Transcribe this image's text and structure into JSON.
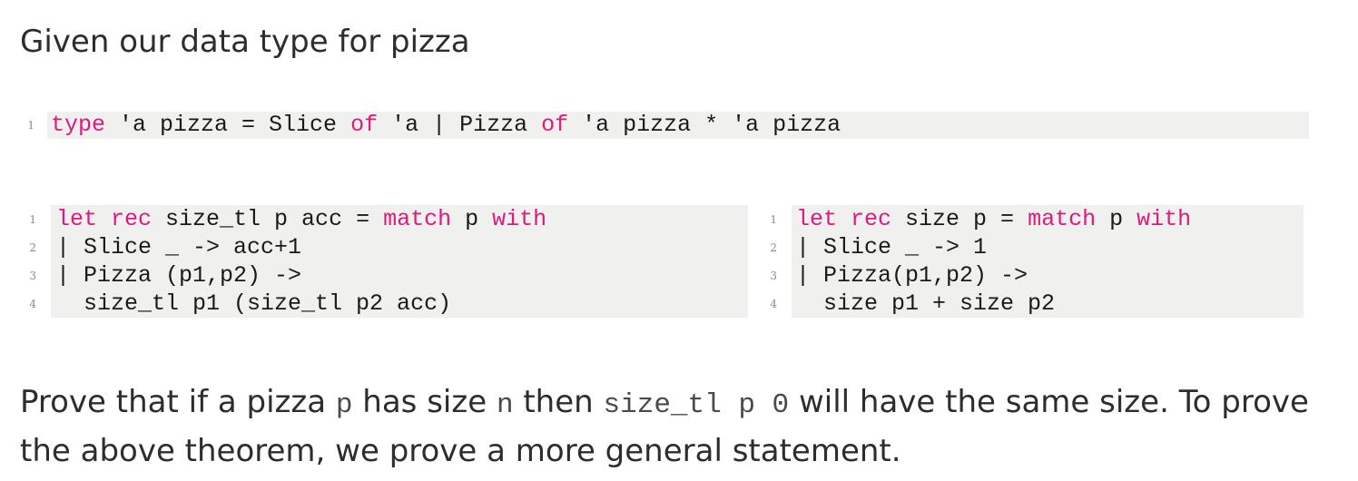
{
  "heading": "Given our data type for pizza",
  "type_block": {
    "lines": [
      {
        "num": "1",
        "tokens": [
          {
            "text": "type",
            "kw": true
          },
          {
            "text": " 'a pizza = Slice ",
            "kw": false
          },
          {
            "text": "of",
            "kw": true
          },
          {
            "text": " 'a | Pizza ",
            "kw": false
          },
          {
            "text": "of",
            "kw": true
          },
          {
            "text": " 'a pizza * 'a pizza",
            "kw": false
          }
        ]
      }
    ]
  },
  "size_tl_block": {
    "lines": [
      {
        "num": "1",
        "tokens": [
          {
            "text": "let rec",
            "kw": true
          },
          {
            "text": " size_tl p acc = ",
            "kw": false
          },
          {
            "text": "match",
            "kw": true
          },
          {
            "text": " p ",
            "kw": false
          },
          {
            "text": "with",
            "kw": true
          }
        ]
      },
      {
        "num": "2",
        "tokens": [
          {
            "text": "| Slice _ -> acc+1",
            "kw": false
          }
        ]
      },
      {
        "num": "3",
        "tokens": [
          {
            "text": "| Pizza (p1,p2) ->",
            "kw": false
          }
        ]
      },
      {
        "num": "4",
        "tokens": [
          {
            "text": "  size_tl p1 (size_tl p2 acc)",
            "kw": false
          }
        ]
      }
    ]
  },
  "size_block": {
    "lines": [
      {
        "num": "1",
        "tokens": [
          {
            "text": "let rec",
            "kw": true
          },
          {
            "text": " size p = ",
            "kw": false
          },
          {
            "text": "match",
            "kw": true
          },
          {
            "text": " p ",
            "kw": false
          },
          {
            "text": "with",
            "kw": true
          }
        ]
      },
      {
        "num": "2",
        "tokens": [
          {
            "text": "| Slice _ -> 1",
            "kw": false
          }
        ]
      },
      {
        "num": "3",
        "tokens": [
          {
            "text": "| Pizza(p1,p2) ->",
            "kw": false
          }
        ]
      },
      {
        "num": "4",
        "tokens": [
          {
            "text": "  size p1 + size p2",
            "kw": false
          }
        ]
      }
    ]
  },
  "paragraph": {
    "part1": "Prove that if a pizza ",
    "code1": "p",
    "part2": " has size ",
    "code2": "n",
    "part3": " then ",
    "code3": "size_tl p 0",
    "part4": " will have the same size. To prove the above theorem, we prove a more general statement."
  }
}
